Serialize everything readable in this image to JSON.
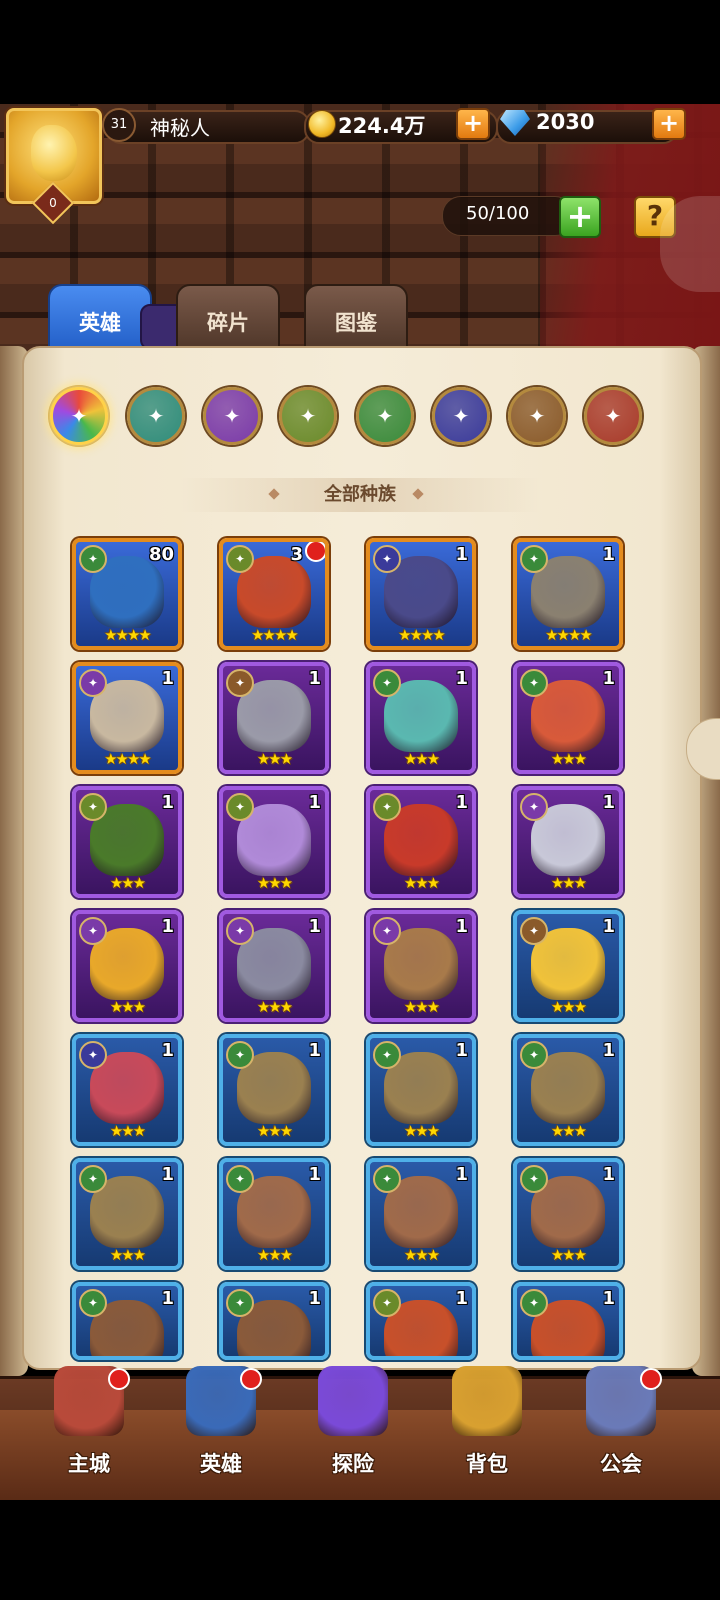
{
  "player": {
    "level": "31",
    "name": "神秘人",
    "avatar_badge": "0"
  },
  "currency": {
    "gold": "224.4万",
    "gems": "2030"
  },
  "capacity": "50/100",
  "tabs": [
    {
      "label": "英雄",
      "active": true
    },
    {
      "label": "碎片",
      "active": false
    },
    {
      "label": "图鉴",
      "active": false
    }
  ],
  "filters": [
    {
      "icon": "all-races-icon",
      "color": "#e8c35a",
      "selected": true
    },
    {
      "icon": "water-race-icon",
      "color": "#2f8c7a",
      "selected": false
    },
    {
      "icon": "arcane-race-icon",
      "color": "#7a3aa8",
      "selected": false
    },
    {
      "icon": "nature-race-icon",
      "color": "#6a8a2a",
      "selected": false
    },
    {
      "icon": "forest-race-icon",
      "color": "#3a8a3a",
      "selected": false
    },
    {
      "icon": "shadow-race-icon",
      "color": "#3a3a9a",
      "selected": false
    },
    {
      "icon": "mech-race-icon",
      "color": "#8a5a2a",
      "selected": false
    },
    {
      "icon": "inferno-race-icon",
      "color": "#a83a2a",
      "selected": false
    }
  ],
  "section_title": "全部种族",
  "heroes": [
    {
      "count": "80",
      "stars": "★★★★",
      "frame": "orange",
      "element": "forest",
      "color": "#2f6fbf",
      "new": false
    },
    {
      "count": "3",
      "stars": "★★★★",
      "frame": "orange",
      "element": "nature",
      "color": "#c84a2a",
      "new": true
    },
    {
      "count": "1",
      "stars": "★★★★",
      "frame": "orange",
      "element": "shadow",
      "color": "#4a4a8a",
      "new": false
    },
    {
      "count": "1",
      "stars": "★★★★",
      "frame": "orange",
      "element": "forest",
      "color": "#8a8070",
      "new": false
    },
    {
      "count": "1",
      "stars": "★★★★",
      "frame": "orange",
      "element": "arcane",
      "color": "#c8b8a0",
      "new": false
    },
    {
      "count": "1",
      "stars": "★★★",
      "frame": "purple",
      "element": "mech",
      "color": "#9a9aa8",
      "new": false
    },
    {
      "count": "1",
      "stars": "★★★",
      "frame": "purple",
      "element": "forest",
      "color": "#5ab8b0",
      "new": false
    },
    {
      "count": "1",
      "stars": "★★★",
      "frame": "purple",
      "element": "forest",
      "color": "#d85a3a",
      "new": false
    },
    {
      "count": "1",
      "stars": "★★★",
      "frame": "purple",
      "element": "nature",
      "color": "#4a7a2a",
      "new": false
    },
    {
      "count": "1",
      "stars": "★★★",
      "frame": "purple",
      "element": "nature",
      "color": "#b08ad8",
      "new": false
    },
    {
      "count": "1",
      "stars": "★★★",
      "frame": "purple",
      "element": "nature",
      "color": "#c83a2a",
      "new": false
    },
    {
      "count": "1",
      "stars": "★★★",
      "frame": "purple",
      "element": "arcane",
      "color": "#c8c8d8",
      "new": false
    },
    {
      "count": "1",
      "stars": "★★★",
      "frame": "purple",
      "element": "arcane",
      "color": "#e8a82a",
      "new": false
    },
    {
      "count": "1",
      "stars": "★★★",
      "frame": "purple",
      "element": "arcane",
      "color": "#8a8aa0",
      "new": false
    },
    {
      "count": "1",
      "stars": "★★★",
      "frame": "purple",
      "element": "arcane",
      "color": "#a87a4a",
      "new": false
    },
    {
      "count": "1",
      "stars": "★★★",
      "frame": "blue",
      "element": "mech",
      "color": "#f0c23a",
      "new": false
    },
    {
      "count": "1",
      "stars": "★★★",
      "frame": "blue",
      "element": "shadow",
      "color": "#c84a5a",
      "new": false
    },
    {
      "count": "1",
      "stars": "★★★",
      "frame": "blue",
      "element": "forest",
      "color": "#9a8050",
      "new": false
    },
    {
      "count": "1",
      "stars": "★★★",
      "frame": "blue",
      "element": "forest",
      "color": "#9a8050",
      "new": false
    },
    {
      "count": "1",
      "stars": "★★★",
      "frame": "blue",
      "element": "forest",
      "color": "#9a8050",
      "new": false
    },
    {
      "count": "1",
      "stars": "★★★",
      "frame": "blue",
      "element": "forest",
      "color": "#9a8050",
      "new": false
    },
    {
      "count": "1",
      "stars": "★★★",
      "frame": "blue",
      "element": "forest",
      "color": "#a06a4a",
      "new": false
    },
    {
      "count": "1",
      "stars": "★★★",
      "frame": "blue",
      "element": "forest",
      "color": "#a06a4a",
      "new": false
    },
    {
      "count": "1",
      "stars": "★★★",
      "frame": "blue",
      "element": "forest",
      "color": "#a06a4a",
      "new": false
    },
    {
      "count": "1",
      "stars": "",
      "frame": "blue",
      "element": "forest",
      "color": "#8a5a3a",
      "new": false
    },
    {
      "count": "1",
      "stars": "",
      "frame": "blue",
      "element": "forest",
      "color": "#8a5a3a",
      "new": false
    },
    {
      "count": "1",
      "stars": "",
      "frame": "blue",
      "element": "nature",
      "color": "#c8502a",
      "new": false
    },
    {
      "count": "1",
      "stars": "",
      "frame": "blue",
      "element": "forest",
      "color": "#c8502a",
      "new": false
    }
  ],
  "nav": [
    {
      "label": "主城",
      "icon": "castle-icon",
      "dot": true,
      "color": "#b84a3a"
    },
    {
      "label": "英雄",
      "icon": "hero-portrait-icon",
      "dot": true,
      "color": "#3a6ab8"
    },
    {
      "label": "探险",
      "icon": "portal-icon",
      "dot": false,
      "color": "#7a4ad8"
    },
    {
      "label": "背包",
      "icon": "backpack-icon",
      "dot": false,
      "color": "#d8a030"
    },
    {
      "label": "公会",
      "icon": "guild-tower-icon",
      "dot": true,
      "color": "#6a7ab8"
    }
  ]
}
